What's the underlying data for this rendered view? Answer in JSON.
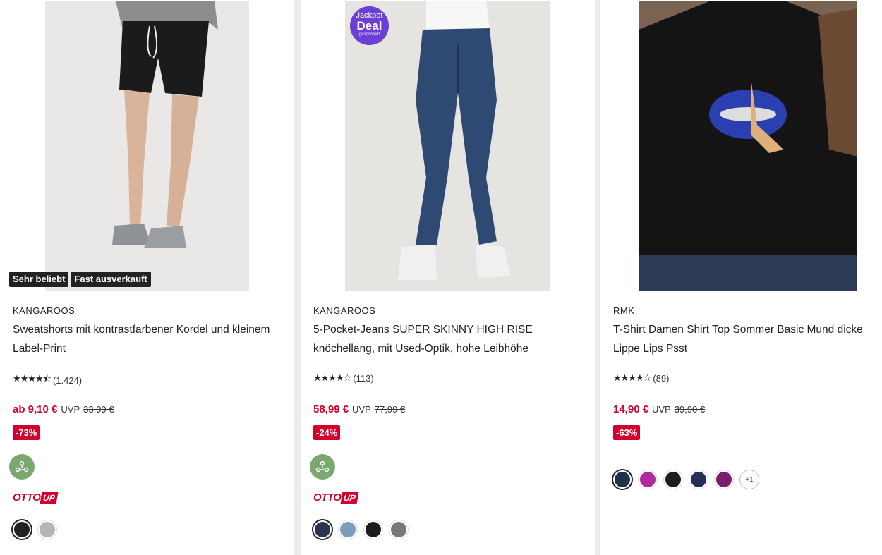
{
  "products": [
    {
      "brand": "KANGAROOS",
      "title": "Sweatshorts mit kontrastfarbener Kordel und kleinem Label-Print",
      "stars": "★★★★⯪",
      "rating_count": "(1.424)",
      "price": "ab 9,10 €",
      "uvp_label": "UVP",
      "old_price": "33,99 €",
      "discount": "-73%",
      "badges": [
        "Sehr beliebt",
        "Fast ausverkauft"
      ],
      "otto_logo_part1": "OTTO",
      "otto_logo_part2": "UP",
      "swatches": [
        "#222222",
        "#b5b5b5"
      ],
      "image_icon": "black-sweatshorts-photo"
    },
    {
      "brand": "KANGAROOS",
      "title": "5-Pocket-Jeans SUPER SKINNY HIGH RISE knöchellang, mit Used-Optik, hohe Leibhöhe",
      "stars": "★★★★☆",
      "rating_count": "(113)",
      "price": "58,99 €",
      "uvp_label": "UVP",
      "old_price": "77,99 €",
      "discount": "-24%",
      "deal_line1": "Jackpot",
      "deal_line2": "Deal",
      "deal_line3": "gesponsert",
      "otto_logo_part1": "OTTO",
      "otto_logo_part2": "UP",
      "swatches": [
        "#2b3550",
        "#7f9bbb",
        "#1c1c1c",
        "#7d7770"
      ],
      "image_icon": "blue-skinny-jeans-photo"
    },
    {
      "brand": "RMK",
      "title": "T-Shirt Damen Shirt Top Sommer Basic Mund dicke Lippe Lips Psst",
      "stars": "★★★★☆",
      "rating_count": "(89)",
      "price": "14,90 €",
      "uvp_label": "UVP",
      "old_price": "39,90 €",
      "discount": "-63%",
      "swatches": [
        "#23304d",
        "#b22a9c",
        "#1c1c1c",
        "#243155",
        "#7a1f6e"
      ],
      "more_colors": "+1",
      "image_icon": "black-tshirt-lips-photo"
    }
  ],
  "colors": {
    "price_red": "#d2002d",
    "deal_purple": "#6b3fd4",
    "eco_green": "#7aa86f"
  }
}
